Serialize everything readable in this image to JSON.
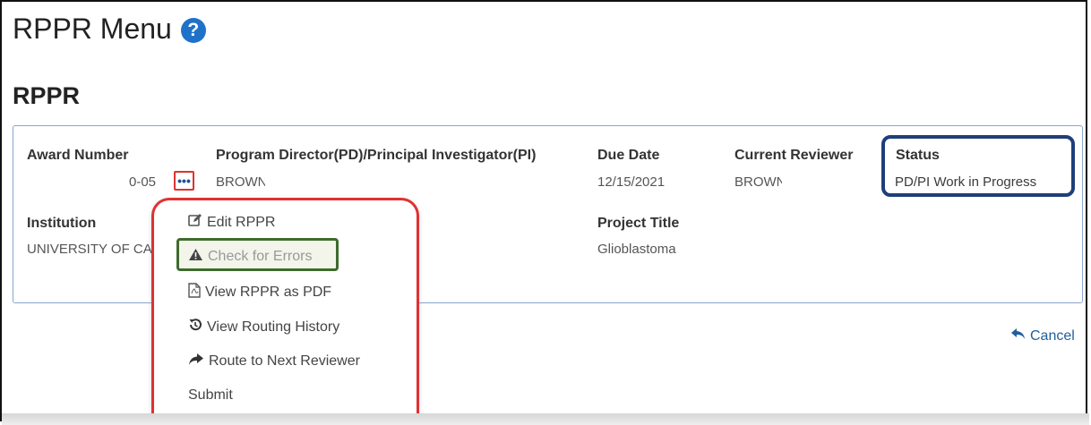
{
  "header": {
    "title": "RPPR Menu",
    "help_icon_glyph": "?"
  },
  "section": {
    "title": "RPPR"
  },
  "award": {
    "award_number_label": "Award Number",
    "award_number_value": "0-05",
    "pd_pi_label": "Program Director(PD)/Principal Investigator(PI)",
    "pd_pi_value": "BROWN",
    "due_date_label": "Due Date",
    "due_date_value": "12/15/2021",
    "current_reviewer_label": "Current Reviewer",
    "current_reviewer_value": "BROWN",
    "status_label": "Status",
    "status_value": "PD/PI Work in Progress",
    "institution_label": "Institution",
    "institution_value": "UNIVERSITY OF CA",
    "project_title_label": "Project Title",
    "project_title_value": "Glioblastoma"
  },
  "actions_button": {
    "label": "•••"
  },
  "menu": {
    "items": [
      {
        "label": "Edit RPPR",
        "icon": "edit-icon"
      },
      {
        "label": "Check for Errors",
        "icon": "warning-icon",
        "disabled": true
      },
      {
        "label": "View RPPR as PDF",
        "icon": "pdf-icon"
      },
      {
        "label": "View Routing History",
        "icon": "history-icon"
      },
      {
        "label": "Route to Next Reviewer",
        "icon": "share-arrow-icon"
      },
      {
        "label": "Submit",
        "icon": ""
      }
    ]
  },
  "cancel": {
    "label": "Cancel",
    "icon": "reply-icon"
  },
  "colors": {
    "link_blue": "#1f5f9e",
    "annotation_red": "#e03131",
    "annotation_navy": "#1f3f7a",
    "annotation_green": "#3d6b2e",
    "card_border": "#8aa5cc"
  }
}
